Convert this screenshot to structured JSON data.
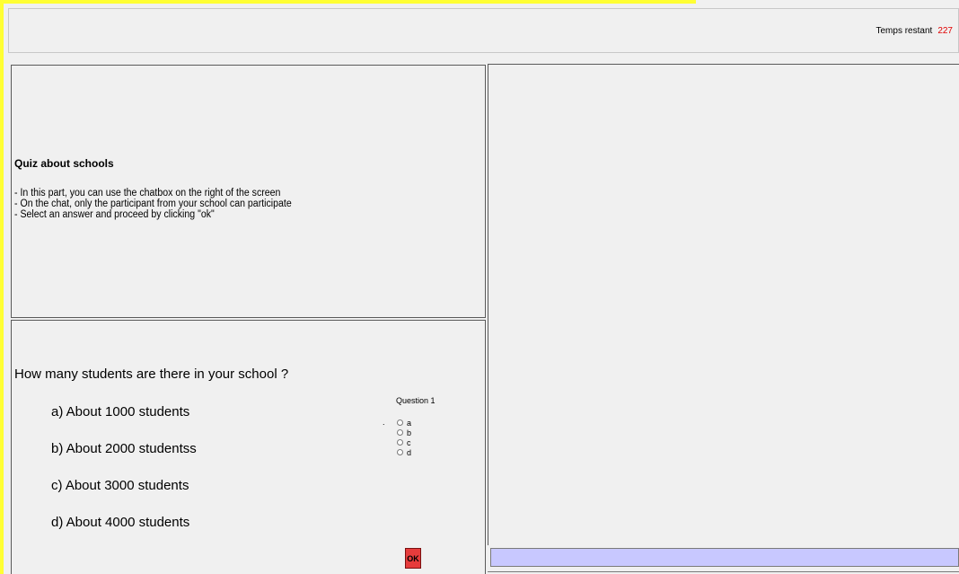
{
  "header": {
    "timer_label": "Temps restant",
    "timer_value": "227",
    "timer_value_color": "#e00000"
  },
  "instructions": {
    "title": "Quiz about schools",
    "lines": [
      "- In this part, you can use the chatbox on the right of the screen",
      "- On the chat, only the participant from your school can participate",
      "- Select an answer and proceed by clicking \"ok\""
    ]
  },
  "question": {
    "text": "How many students are there in your school ?",
    "options": [
      "a) About 1000 students",
      "b) About 2000 studentss",
      "c) About 3000 students",
      "d) About 4000 students"
    ]
  },
  "answer": {
    "label": "Question 1",
    "marker": ".",
    "choices": [
      "a",
      "b",
      "c",
      "d"
    ],
    "ok_label": "OK",
    "ok_color": "#e63c3c"
  },
  "chat": {
    "input_color": "#c8c8ff",
    "input_value": ""
  },
  "colors": {
    "accent_border": "#ffff33",
    "background": "#f0f0f0"
  }
}
